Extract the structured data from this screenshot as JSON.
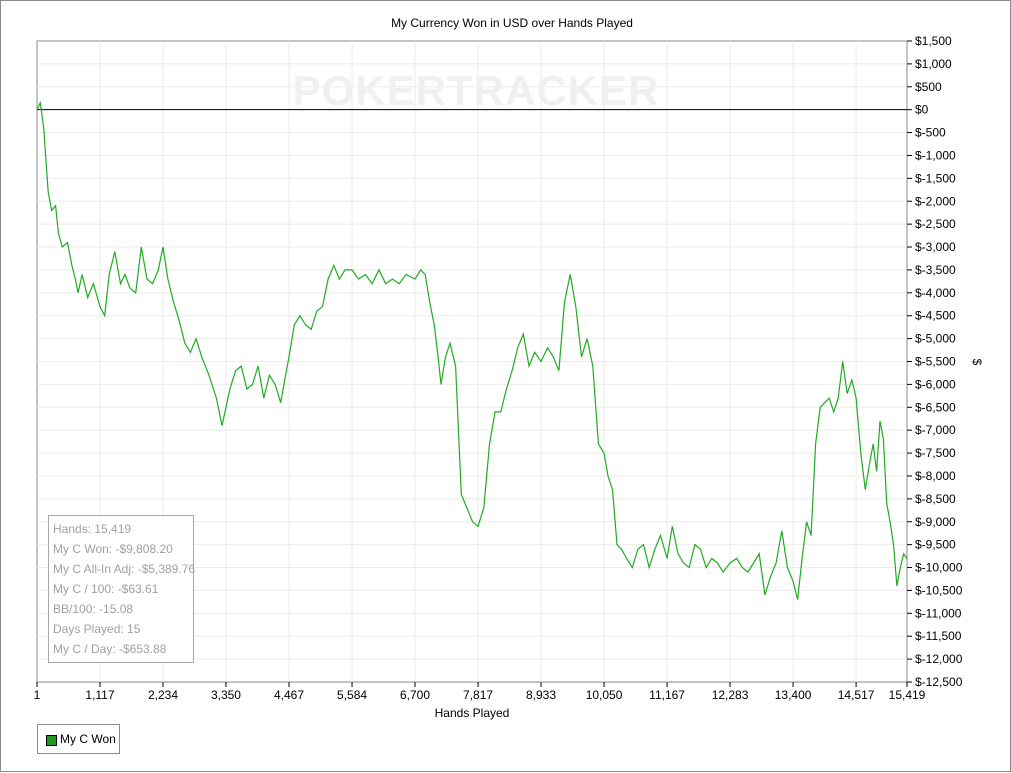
{
  "colors": {
    "series": "#22aa22",
    "grid": "#ebebeb",
    "zero_line": "#000000",
    "watermark": "#f0f0f0"
  },
  "watermark": "POKERTRACKER",
  "stats": {
    "hands": "Hands: 15,419",
    "won": "My C Won: -$9,808.20",
    "allin_adj": "My C All-In Adj: -$5,389.76",
    "per_100": "My C / 100: -$63.61",
    "bb_100": "BB/100: -15.08",
    "days": "Days Played: 15",
    "per_day": "My C / Day: -$653.88"
  },
  "chart_data": {
    "type": "line",
    "title": "My Currency Won in USD over Hands Played",
    "xlabel": "Hands Played",
    "ylabel": "$",
    "xlim": [
      1,
      15419
    ],
    "ylim": [
      -12500,
      1500
    ],
    "grid": true,
    "legend_position": "bottom-left",
    "x_ticks": [
      "1",
      "1,117",
      "2,234",
      "3,350",
      "4,467",
      "5,584",
      "6,700",
      "7,817",
      "8,933",
      "10,050",
      "11,167",
      "12,283",
      "13,400",
      "14,517",
      "15,419"
    ],
    "y_ticks": [
      "$1,500",
      "$1,000",
      "$500",
      "$0",
      "$-500",
      "$-1,000",
      "$-1,500",
      "$-2,000",
      "$-2,500",
      "$-3,000",
      "$-3,500",
      "$-4,000",
      "$-4,500",
      "$-5,000",
      "$-5,500",
      "$-6,000",
      "$-6,500",
      "$-7,000",
      "$-7,500",
      "$-8,000",
      "$-8,500",
      "$-9,000",
      "$-9,500",
      "$-10,000",
      "$-10,500",
      "$-11,000",
      "$-11,500",
      "$-12,000",
      "$-12,500"
    ],
    "series": [
      {
        "name": "My C Won",
        "x": [
          1,
          60,
          120,
          200,
          260,
          330,
          380,
          450,
          540,
          620,
          680,
          730,
          800,
          900,
          1000,
          1117,
          1200,
          1280,
          1380,
          1480,
          1560,
          1650,
          1750,
          1850,
          1950,
          2050,
          2150,
          2234,
          2320,
          2420,
          2520,
          2620,
          2720,
          2820,
          2920,
          3050,
          3180,
          3280,
          3350,
          3420,
          3520,
          3620,
          3720,
          3820,
          3920,
          4020,
          4120,
          4220,
          4320,
          4420,
          4467,
          4560,
          4660,
          4760,
          4860,
          4960,
          5060,
          5160,
          5260,
          5360,
          5460,
          5584,
          5700,
          5820,
          5940,
          6060,
          6180,
          6300,
          6420,
          6540,
          6700,
          6800,
          6880,
          6960,
          7040,
          7100,
          7160,
          7240,
          7320,
          7420,
          7520,
          7620,
          7720,
          7817,
          7920,
          8020,
          8120,
          8220,
          8320,
          8420,
          8520,
          8620,
          8720,
          8820,
          8933,
          9050,
          9150,
          9250,
          9350,
          9450,
          9550,
          9650,
          9750,
          9850,
          9950,
          10050,
          10120,
          10200,
          10280,
          10360,
          10450,
          10550,
          10650,
          10750,
          10850,
          10950,
          11050,
          11167,
          11260,
          11360,
          11460,
          11560,
          11660,
          11760,
          11860,
          11960,
          12060,
          12160,
          12283,
          12400,
          12500,
          12600,
          12700,
          12800,
          12900,
          13000,
          13100,
          13200,
          13300,
          13400,
          13480,
          13560,
          13640,
          13720,
          13800,
          13880,
          13960,
          14040,
          14120,
          14200,
          14280,
          14360,
          14440,
          14517,
          14600,
          14680,
          14760,
          14820,
          14880,
          14940,
          15000,
          15060,
          15120,
          15180,
          15240,
          15300,
          15360,
          15419
        ],
        "values": [
          0,
          150,
          -400,
          -1800,
          -2200,
          -2100,
          -2700,
          -3000,
          -2900,
          -3400,
          -3700,
          -4000,
          -3600,
          -4100,
          -3800,
          -4300,
          -4500,
          -3600,
          -3100,
          -3800,
          -3600,
          -3900,
          -4000,
          -3000,
          -3700,
          -3800,
          -3500,
          -3000,
          -3700,
          -4200,
          -4600,
          -5100,
          -5300,
          -5000,
          -5400,
          -5800,
          -6300,
          -6900,
          -6500,
          -6100,
          -5700,
          -5600,
          -6100,
          -6000,
          -5600,
          -6300,
          -5800,
          -6000,
          -6400,
          -5700,
          -5400,
          -4700,
          -4500,
          -4700,
          -4800,
          -4400,
          -4300,
          -3700,
          -3400,
          -3700,
          -3500,
          -3500,
          -3700,
          -3600,
          -3800,
          -3500,
          -3800,
          -3700,
          -3800,
          -3600,
          -3700,
          -3500,
          -3600,
          -4200,
          -4700,
          -5300,
          -6000,
          -5400,
          -5100,
          -5600,
          -8400,
          -8700,
          -9000,
          -9100,
          -8700,
          -7300,
          -6600,
          -6600,
          -6100,
          -5700,
          -5200,
          -4900,
          -5600,
          -5300,
          -5500,
          -5200,
          -5400,
          -5700,
          -4200,
          -3600,
          -4300,
          -5400,
          -5000,
          -5600,
          -7300,
          -7500,
          -8000,
          -8300,
          -9500,
          -9600,
          -9800,
          -10000,
          -9600,
          -9500,
          -10000,
          -9600,
          -9300,
          -9800,
          -9100,
          -9700,
          -9900,
          -10000,
          -9500,
          -9600,
          -10000,
          -9800,
          -9900,
          -10100,
          -9900,
          -9800,
          -10000,
          -10100,
          -9900,
          -9700,
          -10600,
          -10200,
          -9900,
          -9200,
          -10000,
          -10300,
          -10700,
          -9800,
          -9000,
          -9300,
          -7300,
          -6500,
          -6400,
          -6300,
          -6600,
          -6300,
          -5500,
          -6200,
          -5900,
          -6300,
          -7500,
          -8300,
          -7700,
          -7300,
          -7900,
          -6800,
          -7200,
          -8600,
          -9000,
          -9500,
          -10400,
          -10000,
          -9700,
          -9808
        ]
      }
    ]
  }
}
